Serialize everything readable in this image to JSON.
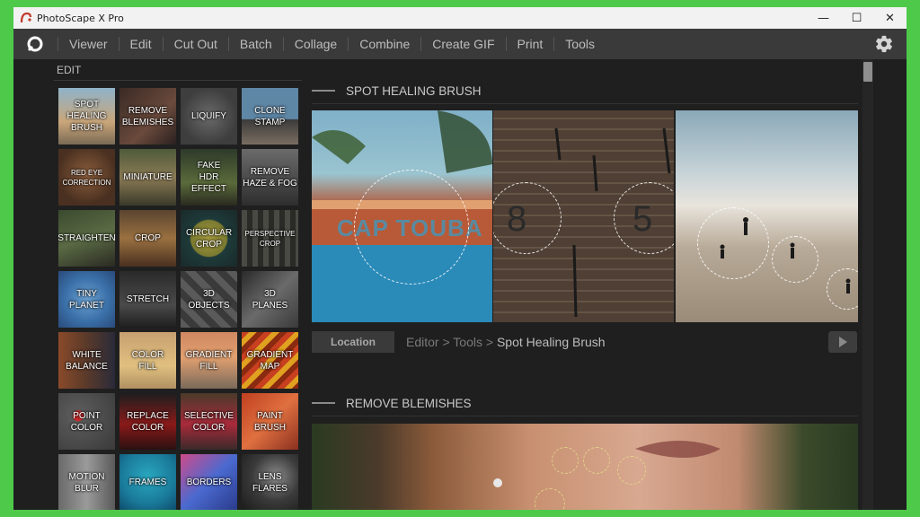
{
  "window": {
    "title": "PhotoScape X Pro",
    "controls": [
      "—",
      "☐",
      "✕"
    ]
  },
  "menu": {
    "items": [
      "Viewer",
      "Edit",
      "Cut Out",
      "Batch",
      "Collage",
      "Combine",
      "Create GIF",
      "Print",
      "Tools"
    ]
  },
  "sidebar": {
    "heading": "EDIT",
    "tools": [
      [
        "SPOT\nHEALING\nBRUSH",
        "REMOVE\nBLEMISHES",
        "LIQUIFY",
        "CLONE\nSTAMP"
      ],
      [
        "RED EYE\nCORRECTION",
        "MINIATURE",
        "FAKE\nHDR EFFECT",
        "REMOVE\nHAZE & FOG"
      ],
      [
        "STRAIGHTEN",
        "CROP",
        "CIRCULAR\nCROP",
        "PERSPECTIVE\nCROP"
      ],
      [
        "TINY\nPLANET",
        "STRETCH",
        "3D\nOBJECTS",
        "3D\nPLANES"
      ],
      [
        "WHITE\nBALANCE",
        "COLOR\nFILL",
        "GRADIENT\nFILL",
        "GRADIENT\nMAP"
      ],
      [
        "POINT\nCOLOR",
        "REPLACE\nCOLOR",
        "SELECTIVE\nCOLOR",
        "PAINT\nBRUSH"
      ],
      [
        "MOTION\nBLUR",
        "FRAMES",
        "BORDERS",
        "LENS\nFLARES"
      ]
    ]
  },
  "sections": [
    {
      "title": "SPOT HEALING BRUSH",
      "image_texts": [
        "CAP TOUBA",
        "8",
        "5"
      ],
      "location_label": "Location",
      "breadcrumb": {
        "part1": "Editor",
        "sep1": ">",
        "part2": "Tools",
        "sep2": ">",
        "current": "Spot Healing Brush"
      }
    },
    {
      "title": "REMOVE BLEMISHES"
    }
  ],
  "colors": {
    "background": "#4fc94a",
    "window": "#1f1f1f",
    "menubar": "#3a3a3a",
    "titlebar": "#f2f2f2"
  }
}
